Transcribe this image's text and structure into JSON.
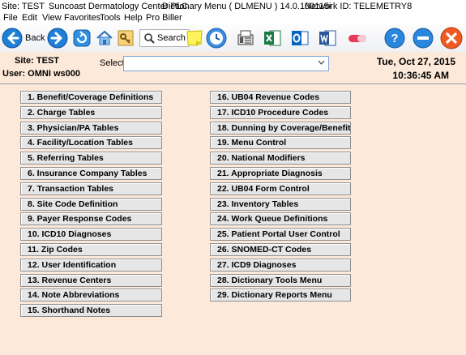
{
  "titlebar": {
    "site": "Site: TEST",
    "practice": "Suncoast Dermatology  Center  PLC",
    "program": "Dictionary Menu  ( DLMENU ) 14.0.100115i",
    "network": "Network ID: TELEMETRY8"
  },
  "menubar": [
    "File",
    "Edit",
    "View",
    "Favorites",
    "Tools",
    "Help",
    "Pro Biller"
  ],
  "toolbar": {
    "back_label": "Back",
    "search_label": "Search"
  },
  "header": {
    "site": "Site: TEST",
    "user": "User: OMNI ws000",
    "select_label": "Select",
    "select_value": "",
    "date": "Tue, Oct 27, 2015",
    "time": "10:36:45 AM"
  },
  "menu_left": [
    "1.  Benefit/Coverage Definitions",
    "2.  Charge Tables",
    "3.  Physician/PA Tables",
    "4.  Facility/Location Tables",
    "5.  Referring Tables",
    "6.  Insurance Company Tables",
    "7.  Transaction Tables",
    "8.  Site Code Definition",
    "9.  Payer Response Codes",
    "10.  ICD10 Diagnoses",
    "11.  Zip Codes",
    "12.  User Identification",
    "13.  Revenue Centers",
    "14.  Note Abbreviations",
    "15.  Shorthand Notes"
  ],
  "menu_right": [
    "16.  UB04 Revenue Codes",
    "17.  ICD10 Procedure Codes",
    "18.  Dunning by Coverage/Benefit",
    "19.  Menu Control",
    "20.  National Modifiers",
    "21.  Appropriate Diagnosis",
    "22.  UB04 Form Control",
    "23.  Inventory Tables",
    "24.  Work Queue Definitions",
    "25.  Patient Portal User Control",
    "26.  SNOMED-CT Codes",
    "27.  ICD9 Diagnoses",
    "28.  Dictionary Tools Menu",
    "29.  Dictionary Reports Menu"
  ],
  "colors": {
    "page_bg": "#fde9d9",
    "button_bg": "#e6e6e6",
    "nav_blue": "#1e7fd8",
    "close_orange": "#f05a22"
  },
  "icons": [
    "back-arrow-icon",
    "forward-arrow-icon",
    "refresh-icon",
    "home-icon",
    "key-icon",
    "search-icon",
    "sticky-note-icon",
    "clock-icon",
    "fax-icon",
    "excel-icon",
    "outlook-icon",
    "word-icon",
    "pill-icon",
    "help-icon",
    "minimize-icon",
    "close-icon"
  ]
}
